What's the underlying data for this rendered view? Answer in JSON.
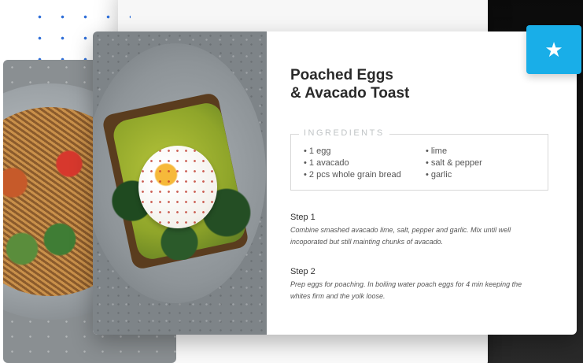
{
  "recipe": {
    "title_line1": "Poached Eggs",
    "title_line2": "& Avacado Toast",
    "ingredients_label": "INGREDIENTS",
    "ingredients_col1": [
      "• 1 egg",
      "• 1 avacado",
      "• 2 pcs whole grain bread"
    ],
    "ingredients_col2": [
      "• lime",
      "• salt & pepper",
      "• garlic"
    ],
    "steps": [
      {
        "title": "Step 1",
        "text": "Combine smashed avacado lime, salt, pepper and garlic. Mix until well incoporated but still mainting chunks of avacado."
      },
      {
        "title": "Step 2",
        "text": "Prep eggs for poaching. In boiling water poach eggs for 4 min keeping the whites firm and the yolk loose."
      }
    ]
  },
  "badge": {
    "icon": "star-icon",
    "glyph": "★",
    "color": "#19aee8"
  },
  "colors": {
    "accent": "#19aee8",
    "dots": "#2f6fd8"
  }
}
